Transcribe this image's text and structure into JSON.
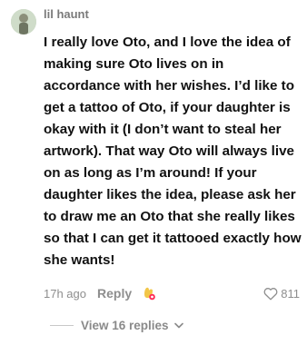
{
  "comment": {
    "username": "lil haunt",
    "text": "I really love Oto, and I love the idea of making sure Oto lives on in accordance with her wishes. I’d like to get a tattoo of Oto, if your daughter is okay with it (I don’t want to steal her artwork). That way Oto will always live on as long as I’m around! If your daughter likes the idea, please ask her to draw me an Oto that she really likes so that I can get it tattooed exactly how she wants!",
    "time": "17h ago",
    "reply_label": "Reply",
    "like_count": "811",
    "view_replies_label": "View 16 replies"
  },
  "icons": {
    "emoji": "creator-liked-emoji-icon",
    "like": "heart-outline-icon",
    "expand": "chevron-down-icon"
  },
  "colors": {
    "text": "#111111",
    "muted": "#8e8e8e",
    "accent": "#fe2c55"
  }
}
